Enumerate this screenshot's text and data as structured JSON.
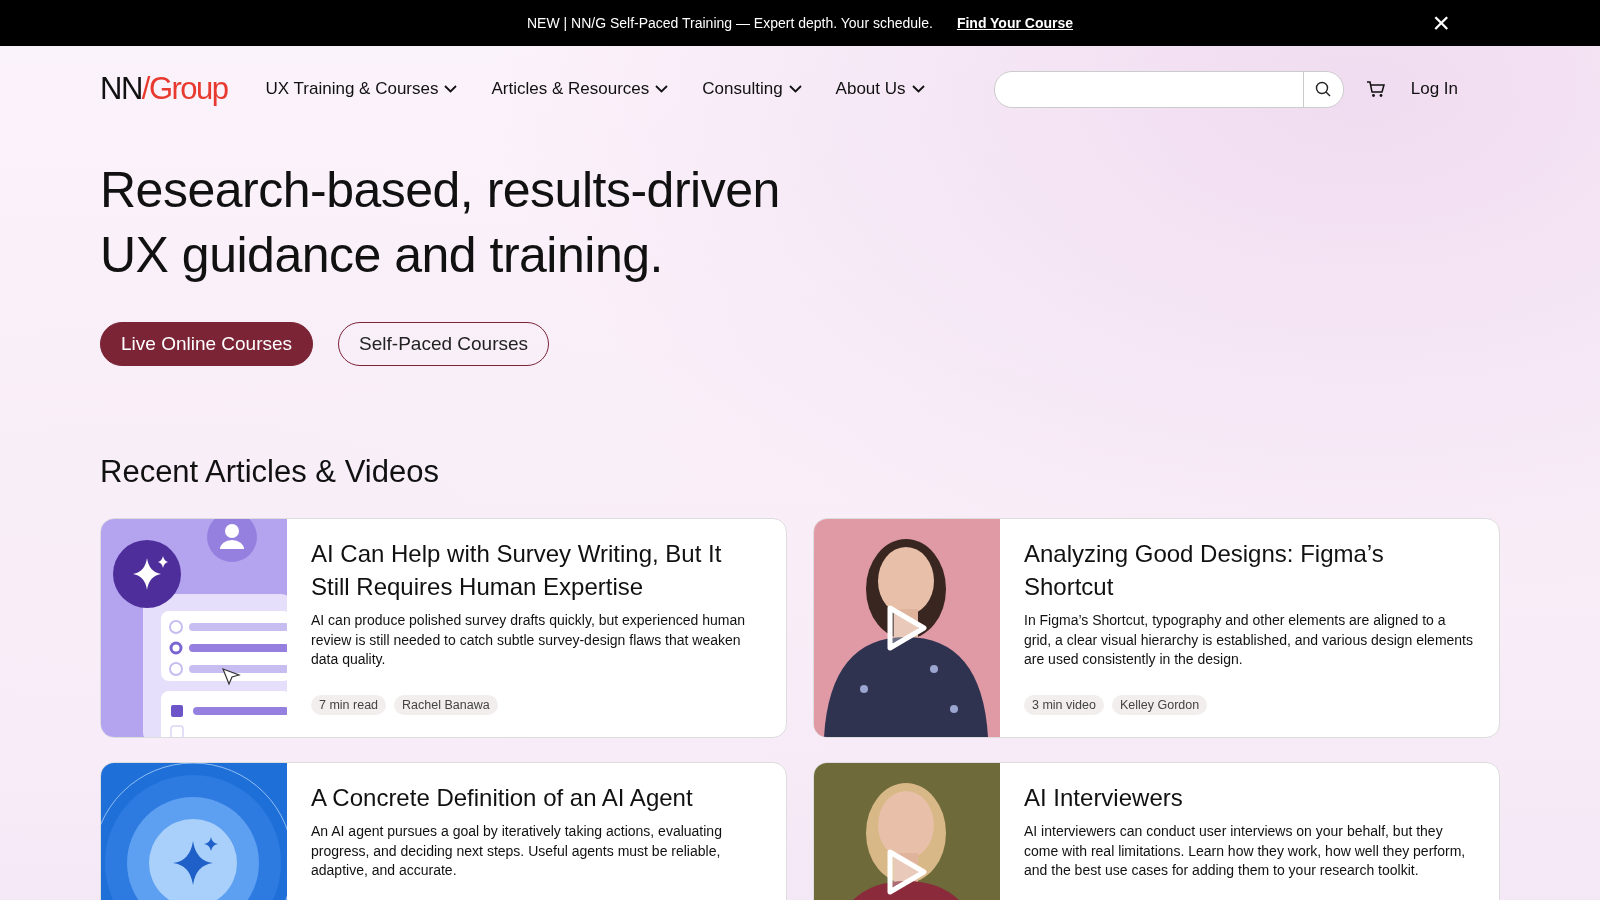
{
  "announcement": {
    "text": "NEW | NN/G Self-Paced Training — Expert depth. Your schedule.",
    "link": "Find Your Course",
    "close": "×"
  },
  "header": {
    "logo": {
      "left": "NN",
      "slash": "/",
      "right": "Group"
    },
    "nav": [
      {
        "label": "UX Training & Courses"
      },
      {
        "label": "Articles & Resources"
      },
      {
        "label": "Consulting"
      },
      {
        "label": "About Us"
      }
    ],
    "login": "Log In"
  },
  "hero": {
    "title": "Research-based, results-driven UX guidance and training.",
    "buttons": [
      {
        "label": "Live Online Courses",
        "kind": "primary"
      },
      {
        "label": "Self-Paced Courses",
        "kind": "outline"
      }
    ]
  },
  "section_title": "Recent Articles & Videos",
  "cards": [
    {
      "kind": "survey",
      "title": "AI Can Help with Survey Writing, But It Still Requires Human Expertise",
      "summary": "AI can produce polished survey drafts quickly, but experienced human review is still needed to catch subtle survey-design flaws that weaken data quality.",
      "tags": [
        "7 min read",
        "Rachel Banawa"
      ]
    },
    {
      "kind": "video",
      "title": "Analyzing Good Designs: Figma’s Shortcut",
      "summary": "In Figma’s Shortcut, typography and other elements are aligned to a grid, a clear visual hierarchy is established, and various design elements are used consistently in the design.",
      "tags": [
        "3 min video",
        "Kelley Gordon"
      ]
    },
    {
      "kind": "agent",
      "title": "A Concrete Definition of an AI Agent",
      "summary": "An AI agent pursues a goal by iteratively taking actions, evaluating progress, and deciding next steps. Useful agents must be reliable, adaptive, and accurate."
    },
    {
      "kind": "video2",
      "title": "AI Interviewers",
      "summary": "AI interviewers can conduct user interviews on your behalf, but they come with real limitations. Learn how they work, how well they perform, and the best use cases for adding them to your research toolkit."
    }
  ]
}
